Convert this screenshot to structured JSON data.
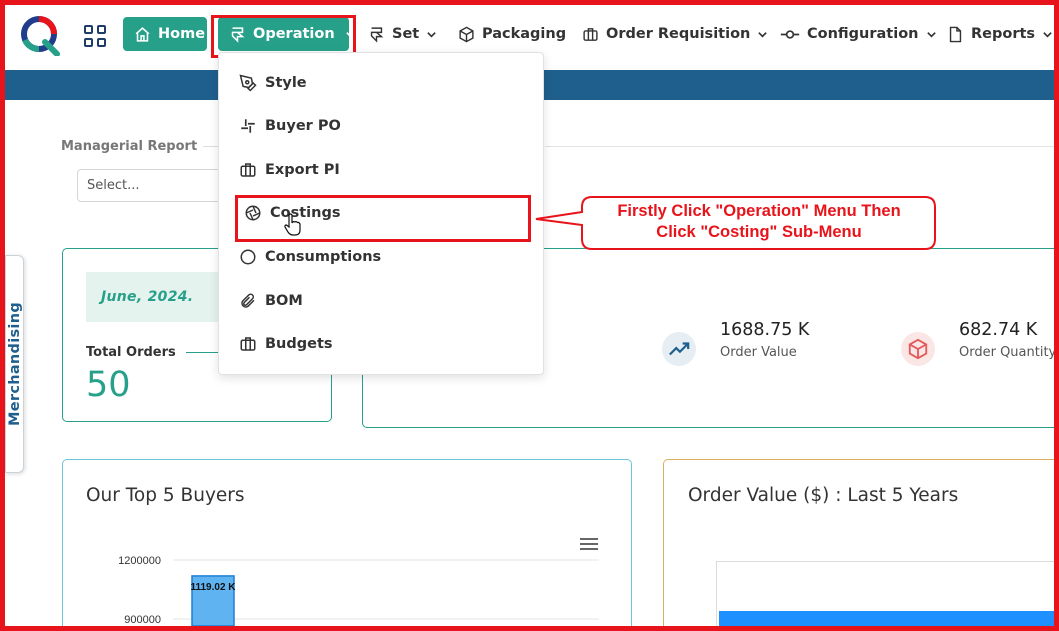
{
  "nav": {
    "home": "Home",
    "operation": "Operation",
    "set": "Set",
    "packaging": "Packaging",
    "order_requisition": "Order Requisition",
    "configuration": "Configuration",
    "reports": "Reports"
  },
  "dropdown": {
    "items": [
      "Style",
      "Buyer PO",
      "Export PI",
      "Costings",
      "Consumptions",
      "BOM",
      "Budgets"
    ]
  },
  "annotation": {
    "line1": "Firstly Click \"Operation\" Menu Then",
    "line2": "Click  \"Costing\" Sub-Menu"
  },
  "sidebar": {
    "tab_label": "Merchandising"
  },
  "filter": {
    "label": "Managerial Report",
    "select_placeholder": "Select..."
  },
  "summary": {
    "date": "June, 2024.",
    "total_orders_label": "Total Orders",
    "total_orders_value": "50",
    "order_value": "1688.75 K",
    "order_value_label": "Order Value",
    "order_quantity": "682.74 K",
    "order_quantity_label": "Order Quantity"
  },
  "buyers_card": {
    "title": "Our Top 5 Buyers"
  },
  "years_card": {
    "title": "Order Value ($) : Last 5 Years"
  },
  "colors": {
    "accent": "#27a08a",
    "band": "#1f5f8e",
    "annotation": "#e8141b",
    "bar": "#5fb3f0"
  },
  "chart_data": {
    "type": "bar",
    "title": "Our Top 5 Buyers",
    "y_ticks": [
      "1200000",
      "900000"
    ],
    "ylim": [
      900000,
      1200000
    ],
    "values": [
      1119020
    ],
    "data_labels": [
      "1119.02 K"
    ]
  }
}
